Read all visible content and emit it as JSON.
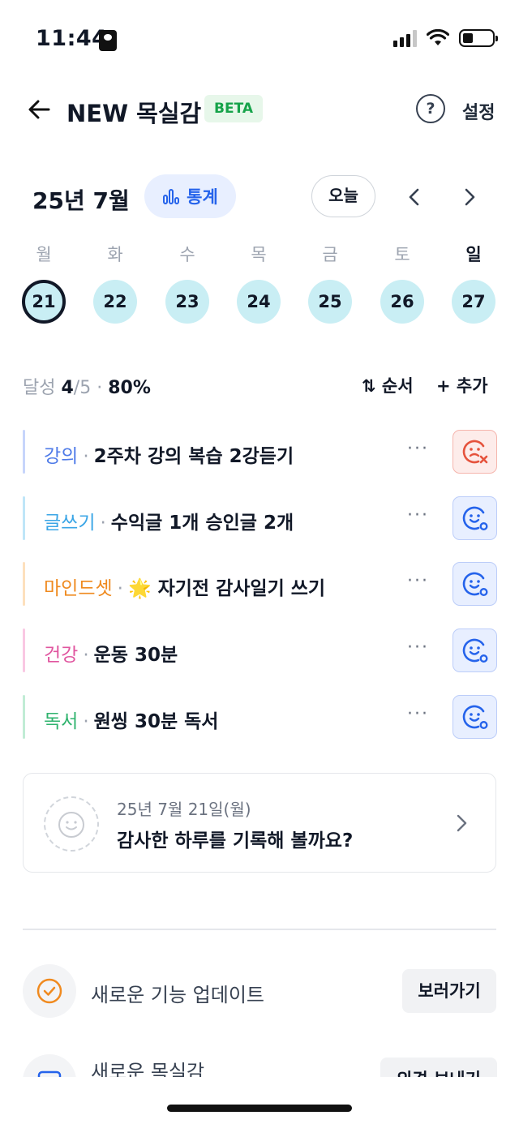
{
  "status_bar": {
    "time": "11:44"
  },
  "header": {
    "title": "NEW 목실감",
    "badge": "BETA",
    "help_label": "?",
    "settings_label": "설정"
  },
  "calendar": {
    "month_label": "25년 7월",
    "stats_label": "통계",
    "today_label": "오늘",
    "weekdays": [
      "월",
      "화",
      "수",
      "목",
      "금",
      "토",
      "일"
    ],
    "dates": [
      "21",
      "22",
      "23",
      "24",
      "25",
      "26",
      "27"
    ],
    "selected_date": "21"
  },
  "progress": {
    "label": "달성",
    "done": "4",
    "total": "/5",
    "separator": "·",
    "percent": "80%"
  },
  "actions": {
    "sort_label": "순서",
    "add_label": "추가"
  },
  "tasks": [
    {
      "category": "강의",
      "title": "2주차 강의 복습 2강듣기",
      "color": "#4f7be8",
      "bar": "#c7d5fb",
      "status": "fail"
    },
    {
      "category": "글쓰기",
      "title": "수익글 1개 승인글 2개",
      "color": "#3aa5e6",
      "bar": "#bfe6f8",
      "status": "ok"
    },
    {
      "category": "마인드셋",
      "title": "🌟 자기전 감사일기 쓰기",
      "color": "#ef8a1f",
      "bar": "#fde0bd",
      "status": "ok"
    },
    {
      "category": "건강",
      "title": "운동 30분",
      "color": "#e0559f",
      "bar": "#f9c8e3",
      "status": "ok"
    },
    {
      "category": "독서",
      "title": "원씽 30분 독서",
      "color": "#2fb36e",
      "bar": "#c1ecd5",
      "status": "ok"
    }
  ],
  "journal": {
    "date": "25년 7월 21일(월)",
    "prompt": "감사한 하루를 기록해 볼까요?"
  },
  "updates": [
    {
      "label": "새로운 기능 업데이트",
      "button": "보러가기",
      "icon": "check-circle-icon"
    },
    {
      "label": "새로운 목실감",
      "button": "의견 보내기",
      "icon": "message-icon"
    }
  ],
  "colors": {
    "accent": "#2563eb",
    "day_bg": "#c9eef4",
    "fail": "#e5533d"
  }
}
